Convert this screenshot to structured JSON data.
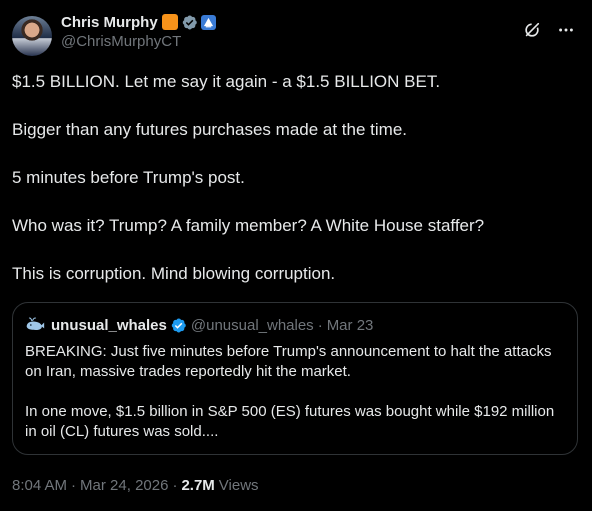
{
  "author": {
    "display_name": "Chris Murphy",
    "handle": "@ChrisMurphyCT",
    "badges": [
      "orange-square-badge",
      "verified-badge",
      "government-label-badge"
    ]
  },
  "top_actions": {
    "icons": [
      "grok-icon",
      "more-icon"
    ],
    "more_label": "···"
  },
  "post": {
    "paragraphs": [
      "$1.5 BILLION. Let me say it again - a $1.5 BILLION BET.",
      "Bigger than any futures purchases made at the time.",
      "5 minutes before Trump's post.",
      "Who was it? Trump? A family member? A White House staffer?",
      "This is corruption. Mind blowing corruption."
    ]
  },
  "quote": {
    "display_name": "unusual_whales",
    "handle": "@unusual_whales",
    "separator": "·",
    "date": "Mar 23",
    "paragraphs": [
      "BREAKING: Just five minutes before Trump's announcement to halt the attacks on Iran, massive trades reportedly hit the market.",
      "In one move, $1.5 billion in S&P 500 (ES) futures was bought while $192 million in oil (CL) futures was sold...."
    ]
  },
  "meta": {
    "time": "8:04 AM",
    "separator": "·",
    "date": "Mar 24, 2026",
    "separator2": "·",
    "views_count": "2.7M",
    "views_label": "Views"
  },
  "colors": {
    "background": "#000000",
    "text_primary": "#e7e9ea",
    "text_secondary": "#71767b",
    "border": "#2f3336",
    "verified_blue": "#1d9bf0",
    "verified_gray": "#829aab",
    "orange_badge": "#f7931a"
  }
}
